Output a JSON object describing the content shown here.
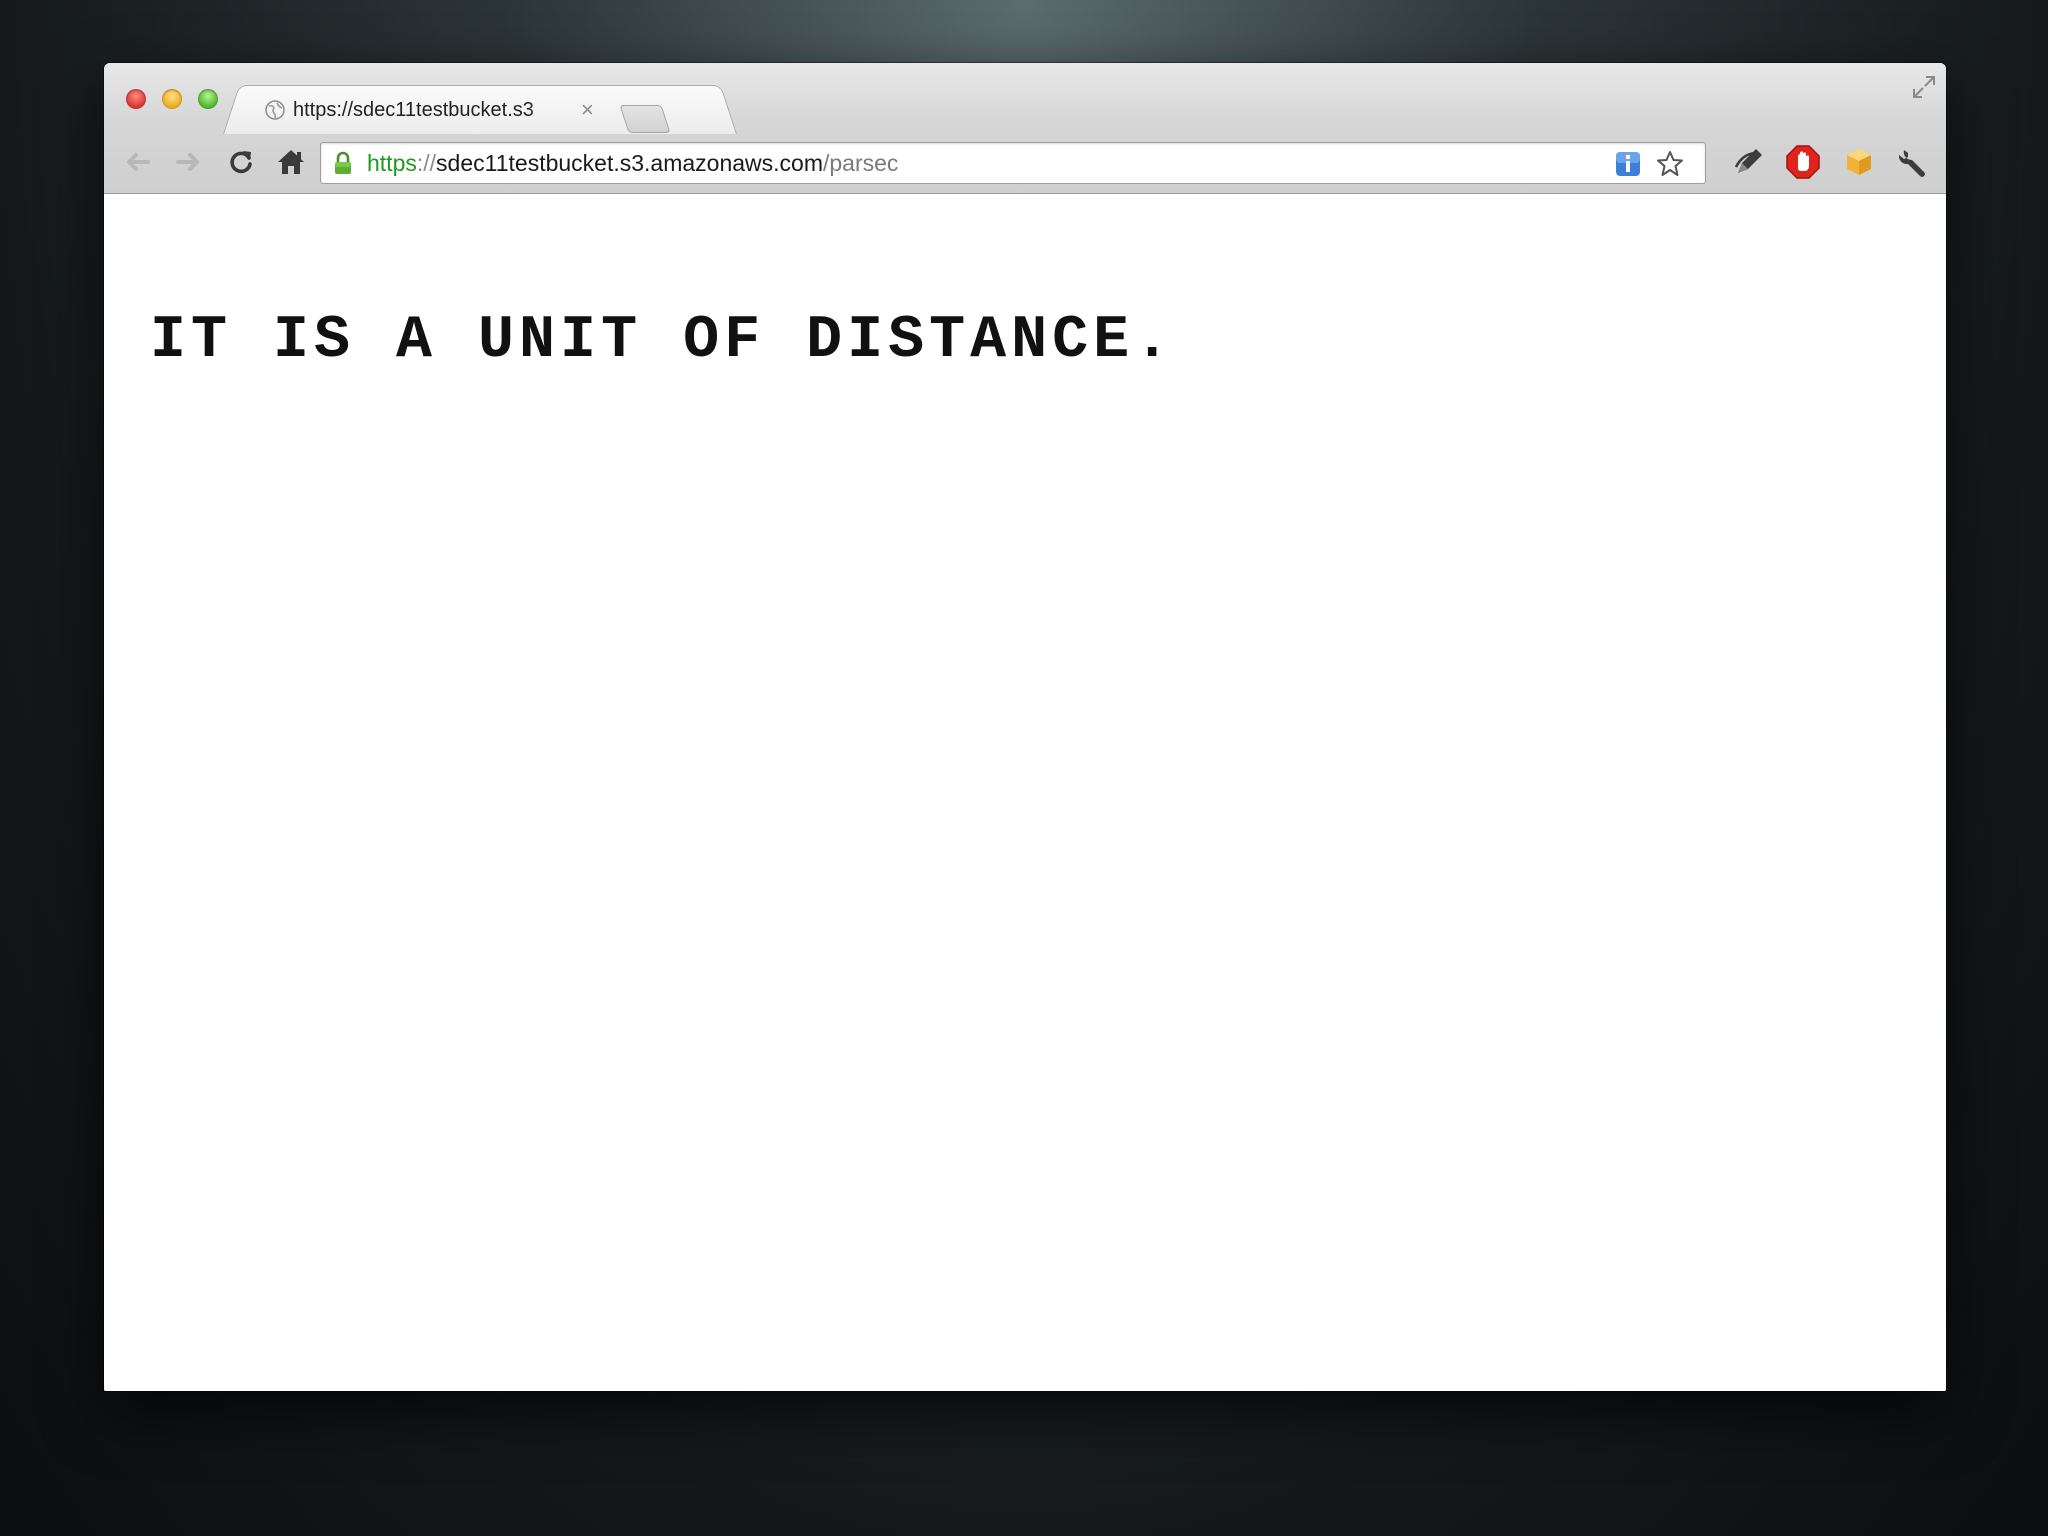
{
  "browser": {
    "tab": {
      "title": "https://sdec11testbucket.s3",
      "close_glyph": "×",
      "favicon": "globe-icon"
    },
    "toolbar": {
      "back_icon": "back-arrow-icon",
      "forward_icon": "forward-arrow-icon",
      "reload_icon": "reload-icon",
      "home_icon": "home-icon",
      "omnibox": {
        "scheme": "https",
        "separator": "://",
        "host": "sdec11testbucket.s3.amazonaws.com",
        "path": "/parsec",
        "secure": true
      },
      "extensions": [
        "info-extension-icon",
        "bookmark-star-icon",
        "pen-extension-icon",
        "stop-extension-icon",
        "cube-extension-icon",
        "wrench-icon"
      ]
    }
  },
  "page": {
    "text": "IT IS A UNIT OF DISTANCE."
  },
  "colors": {
    "scheme_green": "#1f9a1f",
    "stop_red": "#e0241b",
    "info_blue": "#3b7fd8",
    "cube_orange": "#f2b33a"
  }
}
